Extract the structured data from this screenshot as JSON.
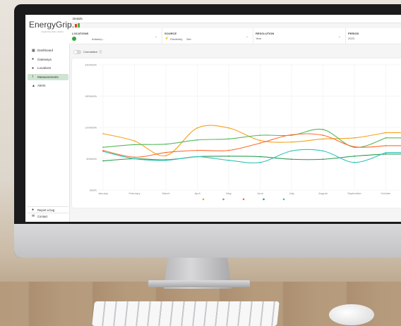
{
  "app": {
    "logo_text": "EnergyGrip.",
    "logo_tagline": "measuring what matters",
    "colors": {
      "accent_green": "#2eaa3f",
      "accent_orange": "#f4a21a",
      "logo_bar_red": "#e63b2e",
      "logo_bar_green": "#49b24b"
    }
  },
  "sidebar": {
    "items": [
      {
        "label": "Dashboard",
        "icon": "grid-icon",
        "active": false
      },
      {
        "label": "Gateways",
        "icon": "location-pin-icon",
        "active": false
      },
      {
        "label": "Locations",
        "icon": "location-pin-icon",
        "active": false
      },
      {
        "label": "Measurements",
        "icon": "chart-icon",
        "active": true
      },
      {
        "label": "Alerts",
        "icon": "bell-icon",
        "active": false
      }
    ],
    "report_bug": "Report a bug",
    "contact": "Contact"
  },
  "header": {
    "breadcrumb": "Details"
  },
  "filters": {
    "locations": {
      "label": "LOCATIONS",
      "value": "Antwerp..."
    },
    "source": {
      "label": "SOURCE",
      "value": "Electricity",
      "extra": "Net"
    },
    "resolution": {
      "label": "RESOLUTION",
      "value": "Year"
    },
    "period": {
      "label": "PERIOD",
      "value": "2023"
    }
  },
  "cumulative_toggle": {
    "label": "Cumulative",
    "on": false
  },
  "chart_data": {
    "type": "line",
    "title": "",
    "xlabel": "",
    "ylabel": "",
    "categories": [
      "January",
      "February",
      "March",
      "April",
      "May",
      "June",
      "July",
      "August",
      "September",
      "October"
    ],
    "y_tick_labels": [
      "0kWh",
      "600kWh",
      "1200kWh",
      "1800kWh",
      "2400kWh"
    ],
    "ylim": [
      0,
      2400
    ],
    "grid": true,
    "series": [
      {
        "color": "#f4a21a",
        "values": [
          1080,
          940,
          660,
          1190,
          1190,
          950,
          920,
          980,
          1000,
          1100
        ]
      },
      {
        "color": "#55b95a",
        "values": [
          820,
          870,
          880,
          960,
          980,
          1050,
          1050,
          1160,
          820,
          1000
        ]
      },
      {
        "color": "#ff6a2b",
        "values": [
          760,
          630,
          720,
          760,
          760,
          900,
          1060,
          1050,
          830,
          850
        ]
      },
      {
        "color": "#2f9b57",
        "values": [
          560,
          600,
          580,
          640,
          650,
          640,
          590,
          590,
          650,
          690
        ]
      },
      {
        "color": "#2cc5b8",
        "values": [
          740,
          600,
          570,
          640,
          570,
          530,
          750,
          750,
          530,
          720
        ]
      }
    ],
    "legend": {
      "position": "bottom"
    }
  }
}
